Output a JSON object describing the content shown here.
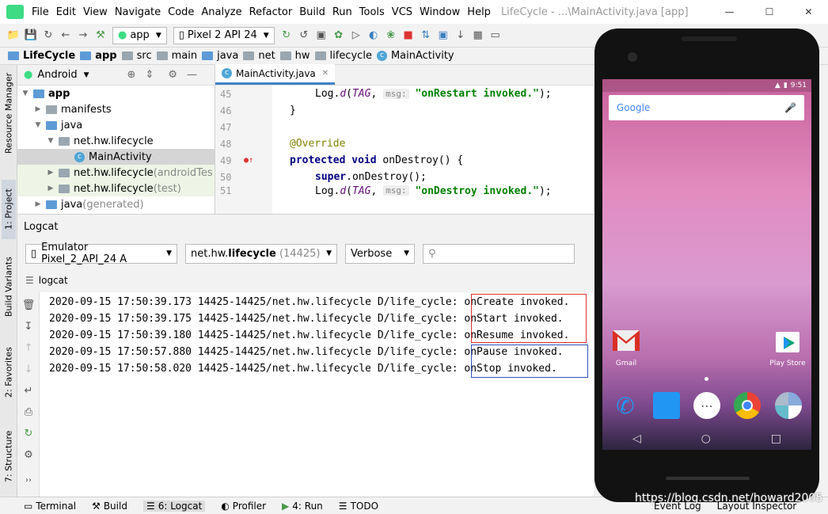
{
  "window": {
    "title": "LifeCycle - ...\\MainActivity.java [app]",
    "menu": [
      "File",
      "Edit",
      "View",
      "Navigate",
      "Code",
      "Analyze",
      "Refactor",
      "Build",
      "Run",
      "Tools",
      "VCS",
      "Window",
      "Help"
    ]
  },
  "toolbar": {
    "module": "app",
    "device": "Pixel 2 API 24"
  },
  "breadcrumb": [
    "LifeCycle",
    "app",
    "src",
    "main",
    "java",
    "net",
    "hw",
    "lifecycle",
    "MainActivity"
  ],
  "left_tabs": [
    "Resource Manager",
    "1: Project",
    "Build Variants",
    "2: Favorites",
    "7: Structure"
  ],
  "project": {
    "view_mode": "Android",
    "tree": [
      {
        "label": "app",
        "suffix": ""
      },
      {
        "label": "manifests",
        "suffix": ""
      },
      {
        "label": "java",
        "suffix": ""
      },
      {
        "label": "net.hw.lifecycle",
        "suffix": ""
      },
      {
        "label": "MainActivity",
        "suffix": ""
      },
      {
        "label": "net.hw.lifecycle",
        "suffix": " (androidTes"
      },
      {
        "label": "net.hw.lifecycle",
        "suffix": " (test)"
      },
      {
        "label": "java",
        "suffix": " (generated)"
      }
    ]
  },
  "editor": {
    "tab": "MainActivity.java",
    "line_numbers": [
      "45",
      "46",
      "47",
      "48",
      "49",
      "50",
      "51"
    ],
    "code": {
      "l45_pre": "Log.",
      "l45_method": "d",
      "l45_tag": "TAG",
      "l45_hint": "msg:",
      "l45_str": "\"onRestart invoked.\"",
      "l45_end": ");",
      "l46": "}",
      "l48": "@Override",
      "l49_kw1": "protected",
      "l49_kw2": "void",
      "l49_rest": "onDestroy() {",
      "l50_kw": "super",
      "l50_rest": ".onDestroy();",
      "l51_pre": "Log.",
      "l51_method": "d",
      "l51_tag": "TAG",
      "l51_hint": "msg:",
      "l51_str": "\"onDestroy invoked.\"",
      "l51_end": ");"
    }
  },
  "logcat": {
    "title": "Logcat",
    "device": "Emulator Pixel_2_API_24 A",
    "process_pkg": "net.hw.",
    "process_bold": "lifecycle",
    "process_pid": " (14425)",
    "level": "Verbose",
    "search_placeholder": "",
    "tab": "logcat",
    "lines": [
      {
        "prefix": "2020-09-15 17:50:39.173 14425-14425/net.hw.lifecycle D/life_cycle: ",
        "msg": "onCreate invoked."
      },
      {
        "prefix": "2020-09-15 17:50:39.175 14425-14425/net.hw.lifecycle D/life_cycle: ",
        "msg": "onStart invoked."
      },
      {
        "prefix": "2020-09-15 17:50:39.180 14425-14425/net.hw.lifecycle D/life_cycle: ",
        "msg": "onResume invoked."
      },
      {
        "prefix": "2020-09-15 17:50:57.880 14425-14425/net.hw.lifecycle D/life_cycle: ",
        "msg": "onPause invoked."
      },
      {
        "prefix": "2020-09-15 17:50:58.020 14425-14425/net.hw.lifecycle D/life_cycle: ",
        "msg": "onStop invoked."
      }
    ],
    "box_colors": {
      "start": "#e03030",
      "stop": "#3050c0"
    }
  },
  "bottom_tabs": [
    "Terminal",
    "Build",
    "6: Logcat",
    "Profiler",
    "4: Run",
    "TODO",
    "Event Log",
    "Layout Inspector"
  ],
  "emulator": {
    "time": "9:51",
    "search_brand": "Google",
    "apps": [
      {
        "label": "Gmail"
      },
      {
        "label": "Play Store"
      }
    ]
  },
  "watermark": "https://blog.csdn.net/howard2005"
}
